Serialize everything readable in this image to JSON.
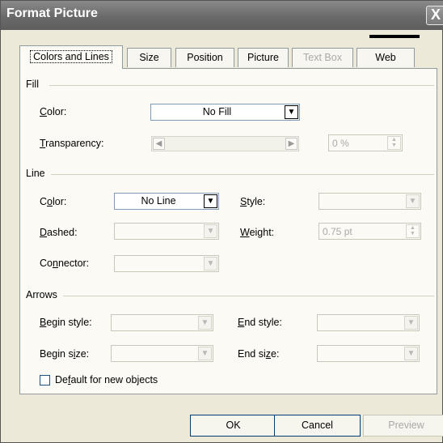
{
  "window": {
    "title": "Format Picture",
    "close_glyph": "X"
  },
  "tabs": [
    {
      "label": "Colors and Lines"
    },
    {
      "label": "Size"
    },
    {
      "label": "Position"
    },
    {
      "label": "Picture"
    },
    {
      "label": "Text Box"
    },
    {
      "label": "Web"
    }
  ],
  "fill": {
    "legend": "Fill",
    "color_label_u": "C",
    "color_label_rest": "olor:",
    "color_value": "No Fill",
    "transparency_label_u": "T",
    "transparency_label_rest": "ransparency:",
    "transparency_value": "0 %"
  },
  "line": {
    "legend": "Line",
    "color_label_a": "C",
    "color_label_u": "o",
    "color_label_b": "lor:",
    "color_value": "No Line",
    "style_label_u": "S",
    "style_label_rest": "tyle:",
    "dashed_label_u": "D",
    "dashed_label_rest": "ashed:",
    "weight_label_u": "W",
    "weight_label_rest": "eight:",
    "weight_value": "0.75 pt",
    "connector_label_a": "Co",
    "connector_label_u": "n",
    "connector_label_b": "nector:"
  },
  "arrows": {
    "legend": "Arrows",
    "begin_style_label_u": "B",
    "begin_style_label_rest": "egin style:",
    "end_style_label_u": "E",
    "end_style_label_rest": "nd style:",
    "begin_size_label_a": "Begin s",
    "begin_size_label_u": "i",
    "begin_size_label_b": "ze:",
    "end_size_label_a": "End si",
    "end_size_label_u": "z",
    "end_size_label_b": "e:"
  },
  "default_checkbox": {
    "label_a": "De",
    "label_u": "f",
    "label_b": "ault for new objects",
    "checked": false
  },
  "buttons": {
    "ok": "OK",
    "cancel": "Cancel",
    "preview": "Preview"
  },
  "glyphs": {
    "down_arrow": "▼",
    "left_arrow": "◀",
    "right_arrow": "▶",
    "spin_up": "▲",
    "spin_down": "▼"
  }
}
